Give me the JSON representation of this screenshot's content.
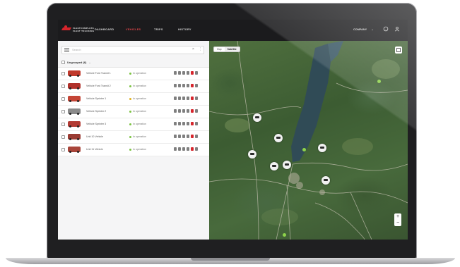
{
  "app": {
    "logo_lines": [
      "FLEETCOMPLETE",
      "FLEET TRACKING"
    ]
  },
  "navbar": {
    "items": [
      {
        "label": "DASHBOARD",
        "active": false
      },
      {
        "label": "VEHICLES",
        "active": true
      },
      {
        "label": "TRIPS",
        "active": false
      },
      {
        "label": "HISTORY",
        "active": false
      }
    ],
    "company_label": "COMPANY",
    "accent_color": "#e4464b"
  },
  "list_panel": {
    "search_placeholder": "Search",
    "group_label": "Ungrouped (6)",
    "vehicles": [
      {
        "name": "Vehicle Ford Transit 1",
        "status": "In operation",
        "status_color": "#7cc343",
        "thumb_color": "#c0392b"
      },
      {
        "name": "Vehicle Ford Transit 2",
        "status": "In operation",
        "status_color": "#7cc343",
        "thumb_color": "#b0302a"
      },
      {
        "name": "Vehicle Sprinter 1",
        "status": "In operation",
        "status_color": "#e0b020",
        "thumb_color": "#c44536"
      },
      {
        "name": "Vehicle Sprinter 2",
        "status": "In operation",
        "status_color": "#7cc343",
        "thumb_color": "#8a8a8a"
      },
      {
        "name": "Vehicle Sprinter 3",
        "status": "In operation",
        "status_color": "#7cc343",
        "thumb_color": "#b23a33"
      },
      {
        "name": "Unit 10 Vehicle",
        "status": "In operation",
        "status_color": "#7cc343",
        "thumb_color": "#9a3b33"
      },
      {
        "name": "Unit 11 Vehicle",
        "status": "In operation",
        "status_color": "#7cc343",
        "thumb_color": "#a8453a"
      }
    ]
  },
  "map": {
    "toggle_options": [
      "Map",
      "Satellite"
    ],
    "active_toggle": "Satellite",
    "zoom_in": "+",
    "zoom_out": "−"
  }
}
